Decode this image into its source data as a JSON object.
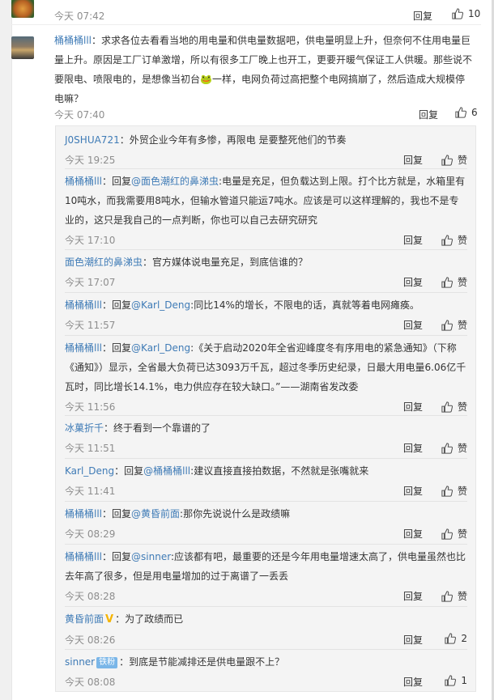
{
  "top_comment": {
    "time": "今天 07:42",
    "reply_label": "回复",
    "likes": "10"
  },
  "main_comment": {
    "user": "桶桶桶lll",
    "text": "：求求各位去看看当地的用电量和供电量数据吧，供电量明显上升，但奈何不住用电量巨量上升。原因是工厂订单激增，所以有很多工厂晚上也开工，更要开暖气保证工人供暖。那些说不要限电、喷限电的，是想像当初台🐸一样，电网负荷过高把整个电网搞崩了，然后造成大规模停电嘛？",
    "time": "今天 07:40",
    "reply_label": "回复",
    "likes": "6"
  },
  "replies": [
    {
      "user": "J0SHUA721",
      "mention": "",
      "text": "：外贸企业今年有多惨，再限电 是要整死他们的节奏",
      "time": "今天 19:25",
      "reply_label": "回复",
      "like_label": "赞"
    },
    {
      "user": "桶桶桶lll",
      "mention": "@面色潮红的鼻涕虫",
      "prefix": "：回复",
      "text": ":电量是充足，但负载达到上限。打个比方就是，水箱里有10吨水，而我需要用8吨水，但输水管道只能运7吨水。应该是可以这样理解的，我也不是专业的，这只是我自己的一点判断，你也可以自己去研究研究",
      "time": "今天 17:10",
      "reply_label": "回复",
      "like_label": "赞"
    },
    {
      "user": "面色潮红的鼻涕虫",
      "mention": "",
      "text": "：官方媒体说电量充足，到底信谁的？",
      "time": "今天 17:07",
      "reply_label": "回复",
      "like_label": "赞"
    },
    {
      "user": "桶桶桶lll",
      "mention": "@Karl_Deng",
      "prefix": "：回复",
      "text": ":同比14%的增长，不限电的话，真就等着电网瘫痪。",
      "time": "今天 11:57",
      "reply_label": "回复",
      "like_label": "赞"
    },
    {
      "user": "桶桶桶lll",
      "mention": "@Karl_Deng",
      "prefix": "：回复",
      "text": ":《关于启动2020年全省迎峰度冬有序用电的紧急通知》（下称《通知》）显示，全省最大负荷已达3093万千瓦，超过冬季历史纪录，日最大用电量6.06亿千瓦时，同比增长14.1%，电力供应存在较大缺口。”——湖南省发改委",
      "time": "今天 11:56",
      "reply_label": "回复",
      "like_label": "赞"
    },
    {
      "user": "冰菓折千",
      "mention": "",
      "text": "：终于看到一个靠谱的了",
      "time": "今天 11:51",
      "reply_label": "回复",
      "like_label": "赞"
    },
    {
      "user": "Karl_Deng",
      "mention": "@桶桶桶lll",
      "prefix": "：回复",
      "text": ":建议直接直接拍数据，不然就是张嘴就来",
      "time": "今天 11:41",
      "reply_label": "回复",
      "like_label": "赞"
    },
    {
      "user": "桶桶桶lll",
      "mention": "@黄昏前面",
      "prefix": "：回复",
      "text": ":那你先说说什么是政绩嘛",
      "time": "今天 08:29",
      "reply_label": "回复",
      "like_label": "赞"
    },
    {
      "user": "桶桶桶lll",
      "mention": "@sinner",
      "prefix": "：回复",
      "text": ":应该都有吧，最重要的还是今年用电量增速太高了，供电量虽然也比去年高了很多，但是用电量增加的过于离谱了一丢丢",
      "time": "今天 08:28",
      "reply_label": "回复",
      "like_label": "赞"
    },
    {
      "user": "黄昏前面",
      "mention": "",
      "badge": "V",
      "text": "：为了政绩而已",
      "time": "今天 08:26",
      "reply_label": "回复",
      "like_label": "2"
    },
    {
      "user": "sinner",
      "mention": "",
      "badge": "铁粉",
      "text": "：到底是节能减排还是供电量跟不上？",
      "time": "今天 08:08",
      "reply_label": "回复",
      "like_label": "1"
    }
  ]
}
